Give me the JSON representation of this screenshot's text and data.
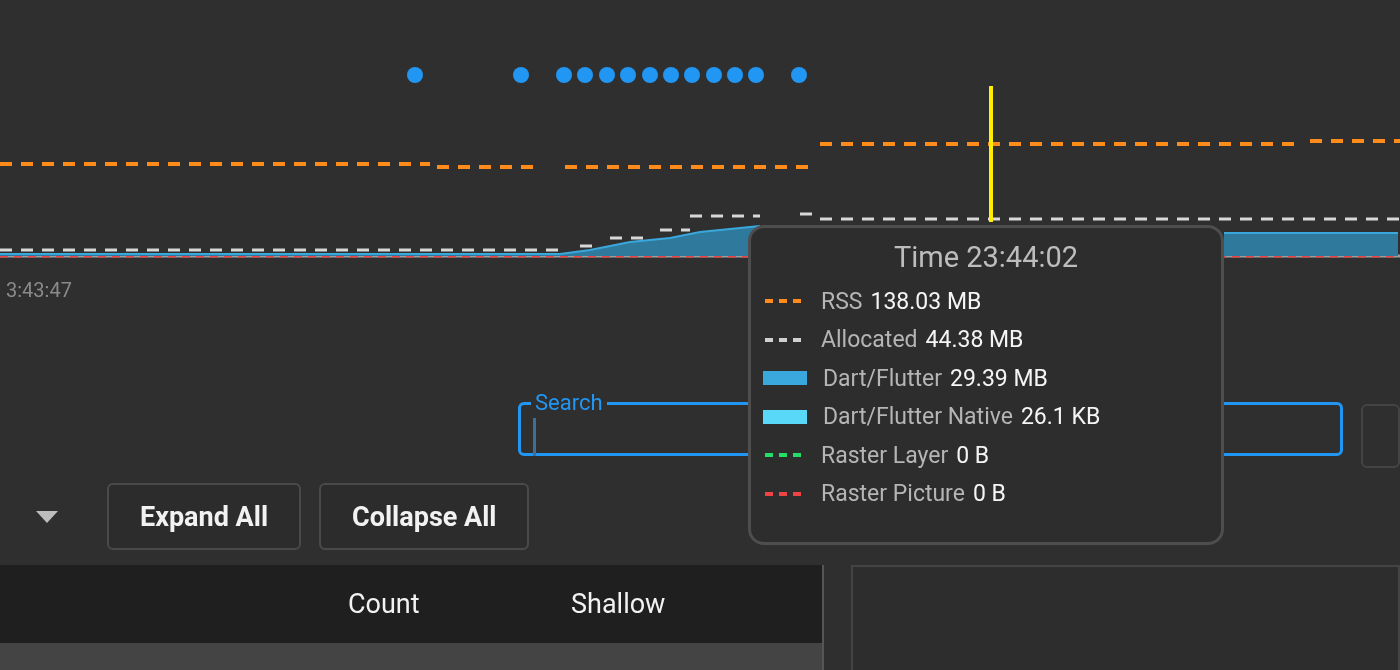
{
  "chart": {
    "time_label": "3:43:47"
  },
  "tooltip": {
    "title": "Time 23:44:02",
    "items": [
      {
        "kind": "dashed",
        "color": "#ff8c1a",
        "label": "RSS",
        "value": "138.03 MB"
      },
      {
        "kind": "dashed",
        "color": "#d0d0d0",
        "label": "Allocated",
        "value": "44.38 MB"
      },
      {
        "kind": "solid",
        "color": "#3aa8dc",
        "label": "Dart/Flutter",
        "value": "29.39 MB"
      },
      {
        "kind": "solid",
        "color": "#5ad8f8",
        "label": "Dart/Flutter Native",
        "value": "26.1 KB"
      },
      {
        "kind": "dashed",
        "color": "#22dd66",
        "label": "Raster Layer",
        "value": "0 B"
      },
      {
        "kind": "dashed",
        "color": "#ee4444",
        "label": "Raster Picture",
        "value": "0 B"
      }
    ]
  },
  "search": {
    "label": "Search"
  },
  "toolbar": {
    "buttons": [
      "Expand All",
      "Collapse All"
    ]
  },
  "table": {
    "columns": [
      "Count",
      "Shallow"
    ]
  }
}
